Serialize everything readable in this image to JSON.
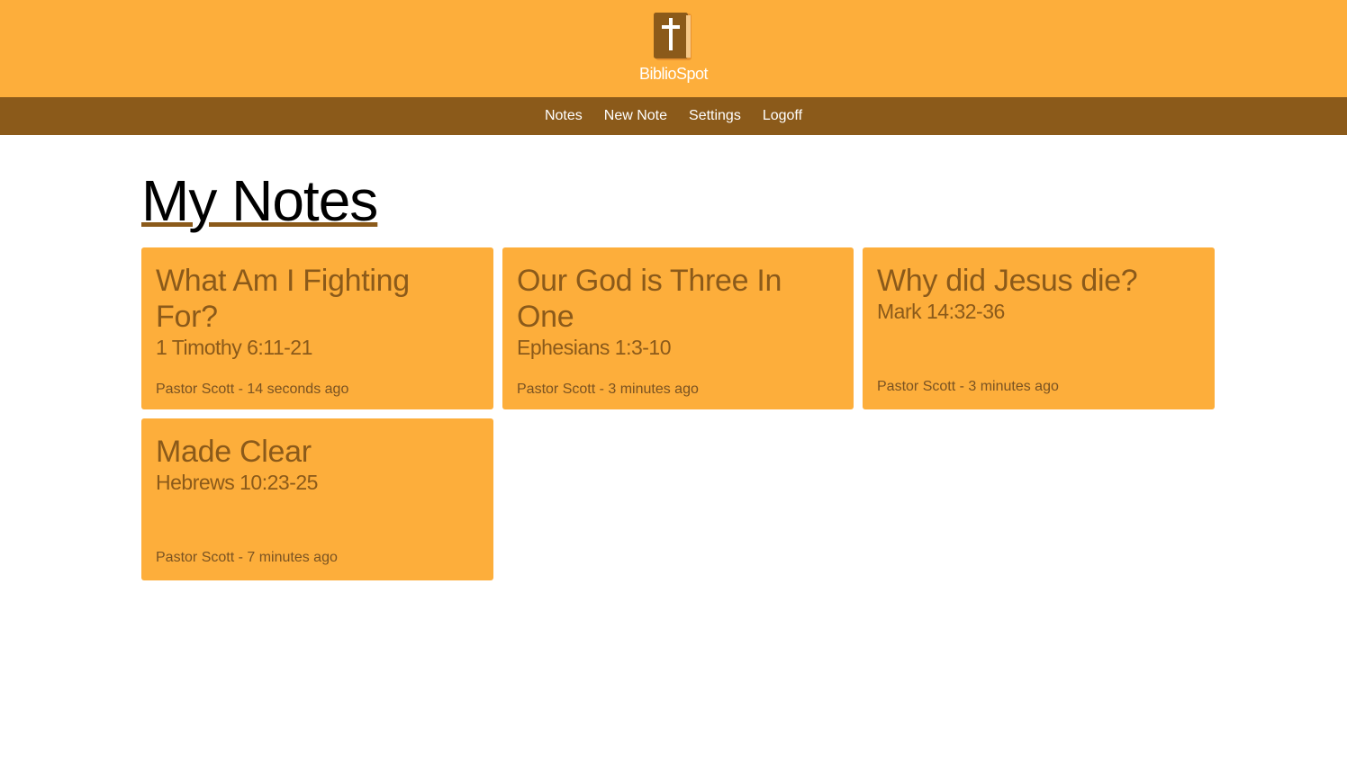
{
  "brand": {
    "name": "BiblioSpot",
    "icon": "bible-cross-icon"
  },
  "colors": {
    "header_bg": "#fdae3b",
    "nav_bg": "#8b5a1a",
    "card_bg": "#fdae3b",
    "card_text": "#8b5a1a"
  },
  "nav": {
    "items": [
      {
        "label": "Notes"
      },
      {
        "label": "New Note"
      },
      {
        "label": "Settings"
      },
      {
        "label": "Logoff"
      }
    ]
  },
  "main": {
    "title": "My Notes",
    "notes": [
      {
        "title": "What Am I Fighting For?",
        "reference": "1 Timothy 6:11-21",
        "author": "Pastor Scott",
        "time": "14 seconds ago",
        "meta": "Pastor Scott - 14 seconds ago"
      },
      {
        "title": "Our God is Three In One",
        "reference": "Ephesians 1:3-10",
        "author": "Pastor Scott",
        "time": "3 minutes ago",
        "meta": "Pastor Scott - 3 minutes ago"
      },
      {
        "title": "Why did Jesus die?",
        "reference": "Mark 14:32-36",
        "author": "Pastor Scott",
        "time": "3 minutes ago",
        "meta": "Pastor Scott - 3 minutes ago"
      },
      {
        "title": "Made Clear",
        "reference": "Hebrews 10:23-25",
        "author": "Pastor Scott",
        "time": "7 minutes ago",
        "meta": "Pastor Scott - 7 minutes ago"
      }
    ]
  }
}
